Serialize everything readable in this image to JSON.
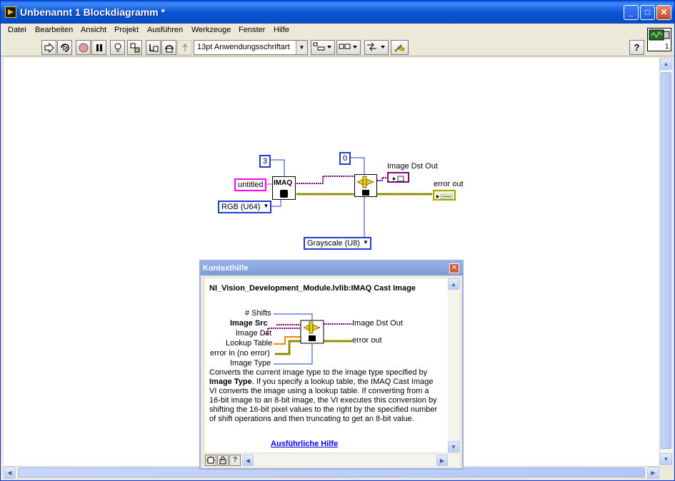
{
  "window": {
    "title": "Unbenannt 1 Blockdiagramm *"
  },
  "menu": {
    "items": [
      "Datei",
      "Bearbeiten",
      "Ansicht",
      "Projekt",
      "Ausführen",
      "Werkzeuge",
      "Fenster",
      "Hilfe"
    ]
  },
  "toolbar": {
    "font_label": "13pt Anwendungsschriftart",
    "help_label": "?"
  },
  "vi_icon": {
    "number": "1"
  },
  "diagram": {
    "const_shifts": "3",
    "const_untitled": "untitled",
    "const_rgb": "RGB (U64)",
    "const_zero": "0",
    "const_grayscale": "Grayscale (U8)",
    "imaq_create_label": "IMAQ",
    "image_dst_out_label": "Image Dst Out",
    "error_out_label": "error out"
  },
  "context_help": {
    "title": "Kontexthilfe",
    "heading": "NI_Vision_Development_Module.lvlib:IMAQ Cast Image",
    "inputs": [
      "# Shifts",
      "Image Src",
      "Image Dst",
      "Lookup Table",
      "error in (no error)",
      "Image Type"
    ],
    "outputs": [
      "Image Dst Out",
      "error out"
    ],
    "desc_part1": "Converts the current image type to the image type specified by ",
    "desc_bold": "Image Type",
    "desc_part2": ". If you specify a lookup table, the IMAQ Cast Image VI converts the image using a lookup table. If converting from a 16-bit image to an 8-bit image, the VI executes this conversion by shifting the 16-bit pixel values to the right by the specified number of shift operations and then truncating to get an 8-bit value.",
    "link": "Ausführliche Hilfe"
  },
  "colors": {
    "titlebar": "#0a55d6",
    "wire_int": "#1c3fd0",
    "wire_string": "#ff00ff",
    "wire_error": "#a6a600",
    "wire_image": "#800080",
    "wire_lookup": "#ff8000"
  }
}
